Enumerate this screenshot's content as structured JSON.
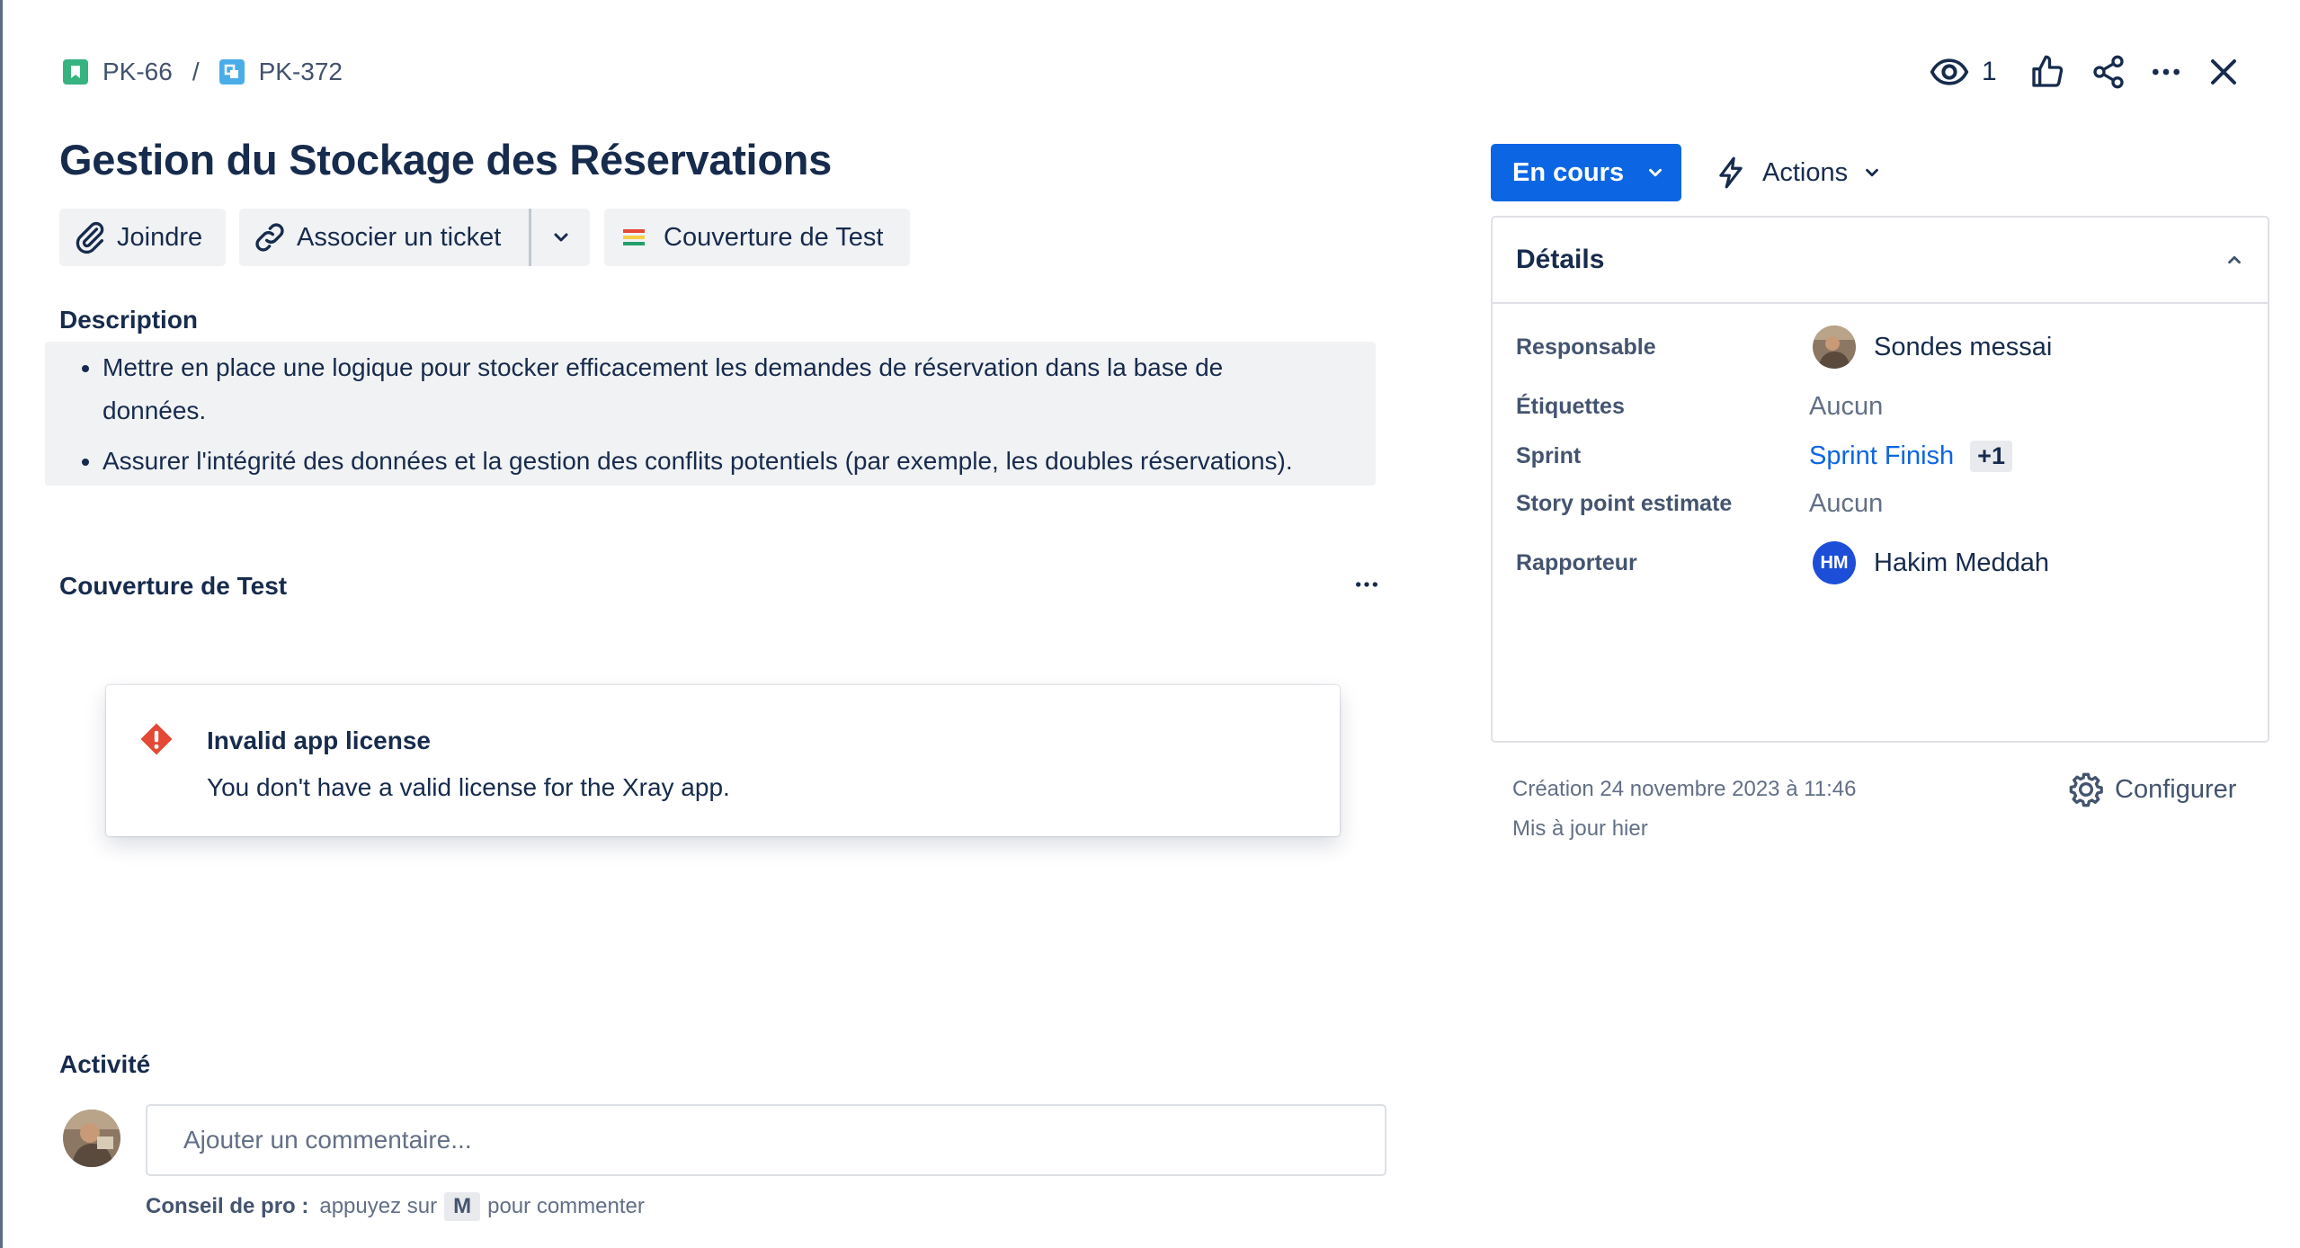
{
  "breadcrumb": {
    "parent_key": "PK-66",
    "separator": "/",
    "issue_key": "PK-372"
  },
  "top_actions": {
    "watch_count": "1"
  },
  "issue": {
    "title": "Gestion du Stockage des Réservations"
  },
  "toolbar": {
    "attach_label": "Joindre",
    "link_label": "Associer un ticket",
    "test_coverage_label": "Couverture de Test"
  },
  "description": {
    "heading": "Description",
    "bullets": [
      "Mettre en place une logique pour stocker efficacement les demandes de réservation dans la base de données.",
      "Assurer l'intégrité des données et la gestion des conflits potentiels (par exemple, les doubles réservations)."
    ]
  },
  "test_coverage": {
    "heading": "Couverture de Test",
    "error_title": "Invalid app license",
    "error_message": "You don't have a valid license for the Xray app."
  },
  "activity": {
    "heading": "Activité",
    "comment_placeholder": "Ajouter un commentaire...",
    "tip_label": "Conseil de pro :",
    "tip_before": "appuyez sur",
    "tip_key": "M",
    "tip_after": "pour commenter"
  },
  "status": {
    "label": "En cours",
    "actions_label": "Actions"
  },
  "details": {
    "heading": "Détails",
    "fields": {
      "assignee_label": "Responsable",
      "assignee_value": "Sondes messai",
      "labels_label": "Étiquettes",
      "labels_value": "Aucun",
      "sprint_label": "Sprint",
      "sprint_value": "Sprint Finish",
      "sprint_extra": "+1",
      "story_points_label": "Story point estimate",
      "story_points_value": "Aucun",
      "reporter_label": "Rapporteur",
      "reporter_initials": "HM",
      "reporter_value": "Hakim Meddah"
    }
  },
  "meta": {
    "created": "Création 24 novembre 2023 à 11:46",
    "updated": "Mis à jour hier",
    "configure_label": "Configurer"
  },
  "colors": {
    "primary": "#0c66e4",
    "story_icon": "#36b37e",
    "subtask_icon": "#4bade8",
    "error": "#e34935"
  }
}
